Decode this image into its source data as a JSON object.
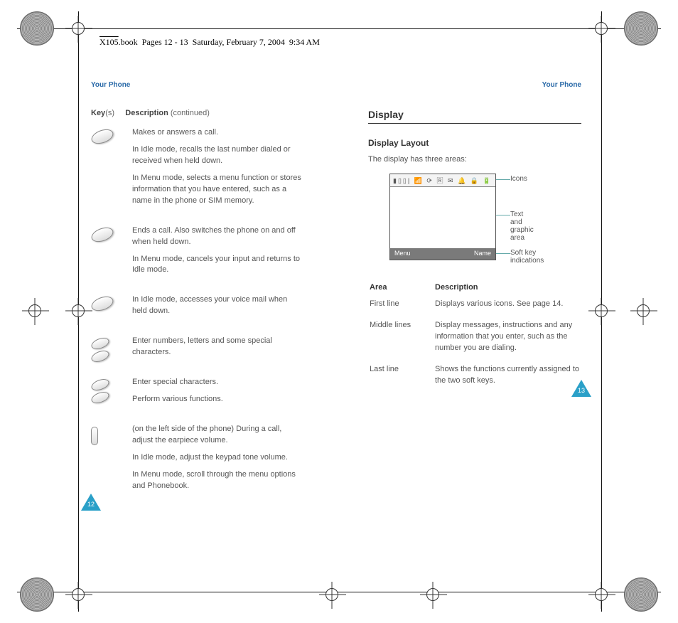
{
  "header": {
    "book_line": "X105.book  Pages 12 - 13  Saturday, February 7, 2004  9:34 AM",
    "overlined": "X105"
  },
  "running_head": {
    "left": "Your Phone",
    "right": "Your Phone"
  },
  "pageNumbers": {
    "left": "12",
    "right": "13"
  },
  "leftPage": {
    "tableHeader": {
      "key": "Key",
      "keySuffix": "(s)",
      "desc": "Description",
      "cont": "(continued)"
    },
    "rows": [
      {
        "icon_name": "send-key-icon",
        "paras": [
          "Makes or answers a call.",
          "In Idle mode, recalls the last number dialed or received when held down.",
          "In Menu mode, selects a menu function or stores information that you have entered, such as a name in the phone or SIM memory."
        ]
      },
      {
        "icon_name": "end-key-icon",
        "paras": [
          "Ends a call. Also switches the phone on and off when held down.",
          "In Menu mode, cancels your input and returns to Idle mode."
        ]
      },
      {
        "icon_name": "one-key-icon",
        "paras": [
          "In Idle mode, accesses your voice mail when held down."
        ]
      },
      {
        "icon_name": "numeric-keys-icon",
        "paras": [
          "Enter numbers, letters and some special characters."
        ]
      },
      {
        "icon_name": "star-hash-keys-icon",
        "paras": [
          "Enter special characters.",
          "Perform various functions."
        ]
      },
      {
        "icon_name": "volume-keys-icon",
        "paras": [
          "(on the left side of the phone) During a call, adjust the earpiece volume.",
          "In Idle mode, adjust the keypad tone volume.",
          "In Menu mode, scroll through the menu options and Phonebook."
        ]
      }
    ]
  },
  "rightPage": {
    "h2": "Display",
    "h3": "Display Layout",
    "intro": "The display has three areas:",
    "screen": {
      "iconsRow": "▮▯▯| 📶 ⟳ 🅁 ✉ 🔔 🔒 🔋",
      "softLeft": "Menu",
      "softRight": "Name"
    },
    "callouts": {
      "icons": "Icons",
      "middle": "Text and graphic area",
      "soft": "Soft key indications"
    },
    "areaTable": {
      "headArea": "Area",
      "headDesc": "Description",
      "rows": [
        {
          "area": "First line",
          "desc": "Displays various icons. See page 14."
        },
        {
          "area": "Middle lines",
          "desc": "Display messages, instructions and any information that you enter, such as the number you are dialing."
        },
        {
          "area": "Last line",
          "desc": "Shows the functions currently assigned to the two soft keys."
        }
      ]
    }
  }
}
